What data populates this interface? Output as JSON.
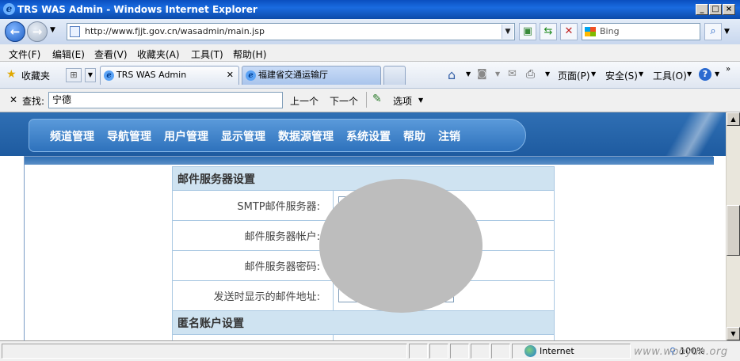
{
  "window": {
    "title": "TRS WAS Admin - Windows Internet Explorer"
  },
  "address": {
    "url": "http://www.fjjt.gov.cn/wasadmin/main.jsp"
  },
  "search": {
    "placeholder": "Bing"
  },
  "menu": [
    "文件(F)",
    "编辑(E)",
    "查看(V)",
    "收藏夹(A)",
    "工具(T)",
    "帮助(H)"
  ],
  "favorites": {
    "label": "收藏夹"
  },
  "tabs": [
    {
      "label": "TRS WAS Admin"
    },
    {
      "label": "福建省交通运输厅"
    }
  ],
  "commandbar": {
    "page": "页面(P)",
    "safety": "安全(S)",
    "tools": "工具(O)"
  },
  "find": {
    "label": "查找:",
    "value": "宁德",
    "prev": "上一个",
    "next": "下一个",
    "options": "选项"
  },
  "nav": [
    "频道管理",
    "导航管理",
    "用户管理",
    "显示管理",
    "数据源管理",
    "系统设置",
    "帮助",
    "注销"
  ],
  "form": {
    "mail_section": "邮件服务器设置",
    "smtp_label": "SMTP邮件服务器:",
    "account_label": "邮件服务器帐户:",
    "password_label": "邮件服务器密码:",
    "sender_label": "发送时显示的邮件地址:",
    "anon_section": "匿名账户设置"
  },
  "status": {
    "zone": "Internet",
    "zoom": "100%"
  },
  "watermark": "www.wooyun.org"
}
